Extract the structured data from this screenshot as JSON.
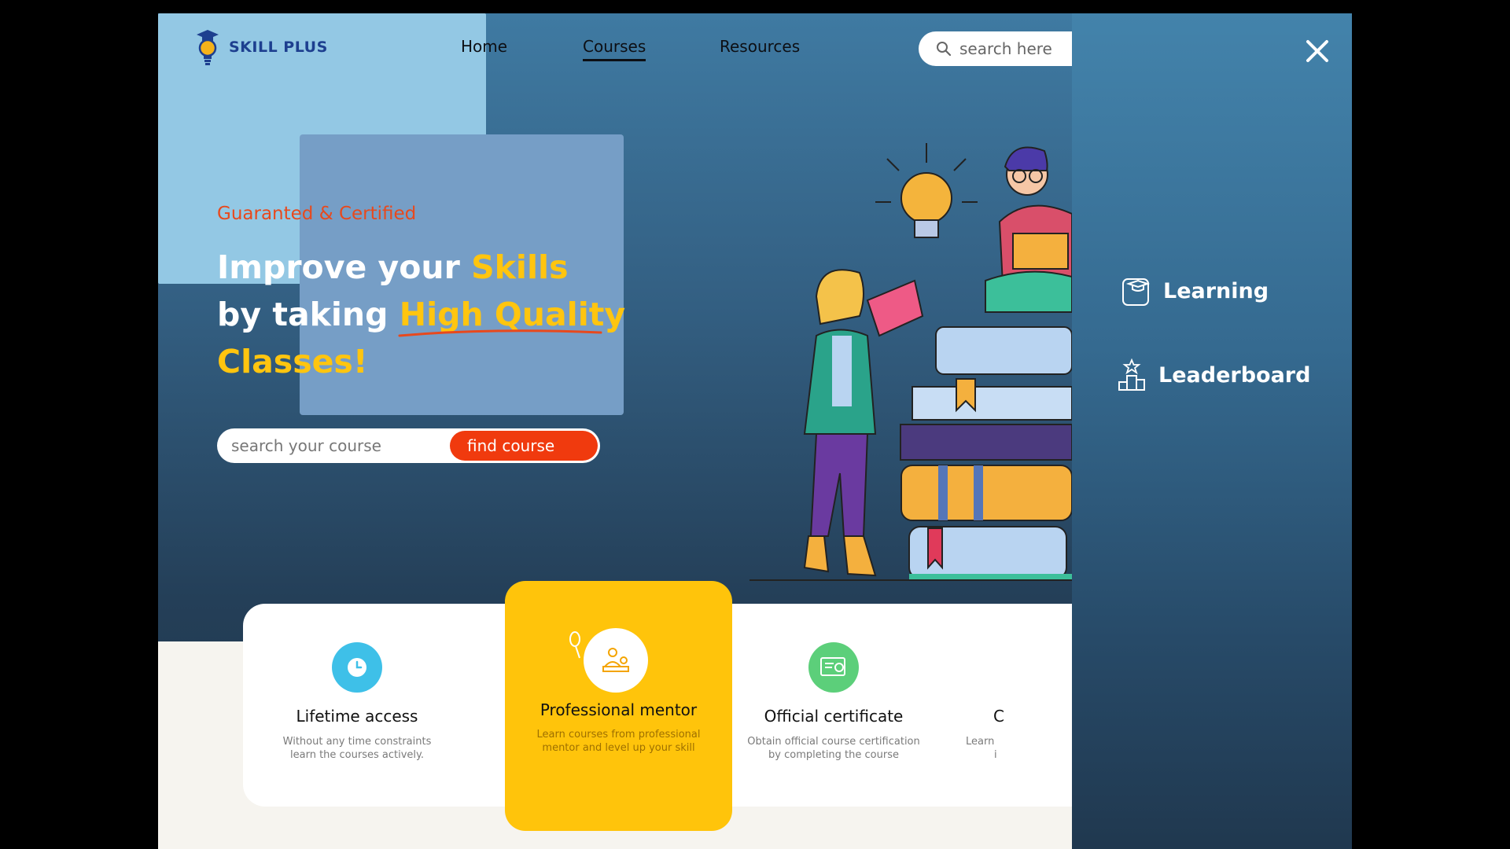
{
  "brand": {
    "name": "SKILL PLUS"
  },
  "nav": {
    "items": [
      {
        "label": "Home"
      },
      {
        "label": "Courses"
      },
      {
        "label": "Resources"
      }
    ]
  },
  "top_search": {
    "placeholder": "search here"
  },
  "hero": {
    "tagline": "Guaranted & Certified",
    "line1_plain": "Improve your ",
    "line1_hl": "Skills",
    "line2_plain": "by taking ",
    "line2_hl": "High Quality",
    "line3_hl": "Classes!"
  },
  "course_search": {
    "placeholder": "search your course",
    "button": "find course"
  },
  "features": [
    {
      "title": "Lifetime access",
      "desc_l1": "Without any time constraints",
      "desc_l2": "learn the courses actively.",
      "icon": "clock-icon",
      "color": "#3ec0e8"
    },
    {
      "title": "Professional mentor",
      "desc_l1": "Learn courses from professional",
      "desc_l2": "mentor and level up your skill",
      "icon": "mentor-icon",
      "color": "#ffc40b"
    },
    {
      "title": "Official certificate",
      "desc_l1": "Obtain official course certification",
      "desc_l2": "by completing the course",
      "icon": "certificate-icon",
      "color": "#5ccf7a"
    },
    {
      "title": "C",
      "desc_l1": "Learn",
      "desc_l2": "i",
      "icon": "",
      "color": ""
    }
  ],
  "drawer": {
    "items": [
      {
        "label": "Learning",
        "icon": "graduation-box-icon"
      },
      {
        "label": "Leaderboard",
        "icon": "podium-icon"
      }
    ]
  },
  "colors": {
    "accent_orange": "#f03a0e",
    "accent_yellow": "#ffc50f",
    "logo_blue": "#1d3f8f"
  }
}
